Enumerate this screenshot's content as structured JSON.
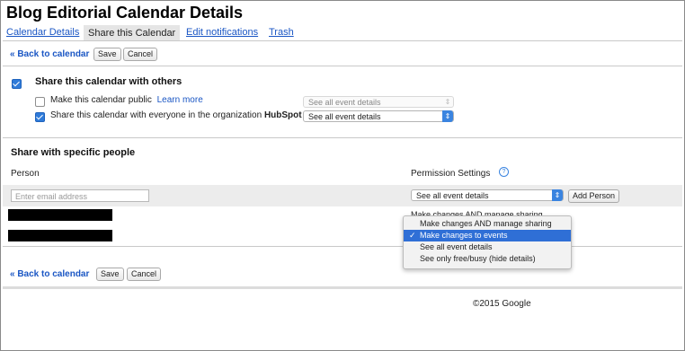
{
  "header": {
    "title": "Blog Editorial Calendar Details"
  },
  "tabs": [
    {
      "label": "Calendar Details",
      "active": false
    },
    {
      "label": "Share this Calendar",
      "active": true
    },
    {
      "label": "Edit notifications",
      "active": false
    },
    {
      "label": "Trash",
      "active": false
    }
  ],
  "toolbar": {
    "back_label": "« Back to calendar",
    "save_label": "Save",
    "cancel_label": "Cancel"
  },
  "share_others": {
    "label": "Share this calendar with others",
    "checked": true,
    "public": {
      "label": "Make this calendar public",
      "learn_more": "Learn more",
      "checked": false,
      "select_value": "See all event details",
      "disabled": true
    },
    "org": {
      "label_prefix": "Share this calendar with everyone in the organization",
      "org_name": "HubSpot",
      "checked": true,
      "select_value": "See all event details"
    }
  },
  "specific": {
    "heading": "Share with specific people",
    "col_person": "Person",
    "col_permission": "Permission Settings",
    "help_icon": "?",
    "email_placeholder": "Enter email address",
    "new_permission": "See all event details",
    "add_person_label": "Add Person",
    "row_partial_text": "Make changes AND manage sharing"
  },
  "dropdown": {
    "options": [
      {
        "label": "Make changes AND manage sharing",
        "selected": false
      },
      {
        "label": "Make changes to events",
        "selected": true
      },
      {
        "label": "See all event details",
        "selected": false
      },
      {
        "label": "See only free/busy (hide details)",
        "selected": false
      }
    ],
    "check_glyph": "✓"
  },
  "footer": {
    "copyright": "©2015 Google"
  },
  "colors": {
    "link": "#1a56c4",
    "accent": "#2f6fd6",
    "band": "#ececec"
  }
}
